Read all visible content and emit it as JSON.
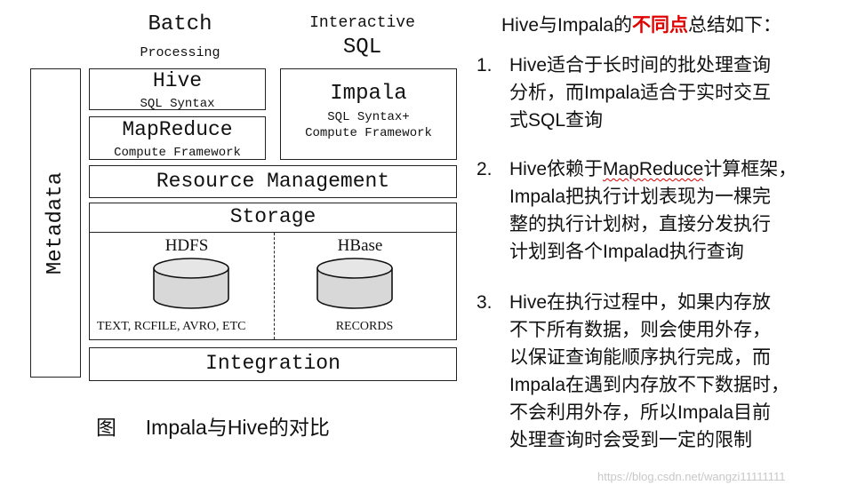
{
  "diagram": {
    "batch": {
      "title": "Batch",
      "subtitle": "Processing"
    },
    "interactive": {
      "title": "Interactive",
      "subtitle": "SQL"
    },
    "metadata": "Metadata",
    "hive": {
      "title": "Hive",
      "subtitle": "SQL Syntax"
    },
    "mapreduce": {
      "title": "MapReduce",
      "subtitle": "Compute Framework"
    },
    "impala": {
      "title": "Impala",
      "subtitle_line1": "SQL Syntax+",
      "subtitle_line2": "Compute Framework"
    },
    "resource_management": "Resource Management",
    "storage": {
      "title": "Storage",
      "hdfs": {
        "label": "HDFS",
        "formats": "TEXT, RCFILE, AVRO, ETC"
      },
      "hbase": {
        "label": "HBase",
        "formats": "RECORDS"
      }
    },
    "integration": "Integration"
  },
  "caption": {
    "prefix": "图",
    "text": "Impala与Hive的对比"
  },
  "summary": {
    "title_before": "Hive与Impala的",
    "title_accent": "不同点",
    "title_after": "总结如下：",
    "accent_color": "#e00000",
    "items": [
      {
        "num": "1.",
        "lines": [
          "Hive适合于长时间的批处理查询",
          "分析，而Impala适合于实时交互",
          "式SQL查询"
        ]
      },
      {
        "num": "2.",
        "line1_before": "Hive依赖于",
        "line1_underlined": "MapReduce",
        "line1_after": "计算框架，",
        "lines": [
          "Impala把执行计划表现为一棵完",
          "整的执行计划树，直接分发执行",
          "计划到各个Impalad执行查询"
        ]
      },
      {
        "num": "3.",
        "lines": [
          "Hive在执行过程中，如果内存放",
          "不下所有数据，则会使用外存，",
          "以保证查询能顺序执行完成，而",
          "Impala在遇到内存放不下数据时，",
          "不会利用外存，所以Impala目前",
          "处理查询时会受到一定的限制"
        ]
      }
    ]
  },
  "watermark": "https://blog.csdn.net/wangzi11111111"
}
